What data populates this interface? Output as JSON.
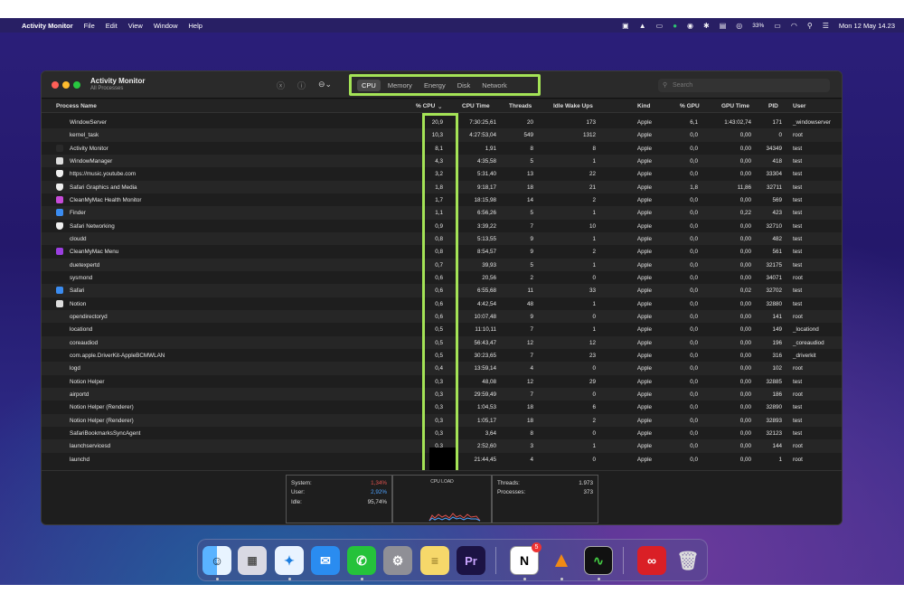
{
  "menubar": {
    "app": "Activity Monitor",
    "items": [
      "File",
      "Edit",
      "View",
      "Window",
      "Help"
    ],
    "battery": "33%",
    "datetime": "Mon 12 May  14.23"
  },
  "window": {
    "title": "Activity Monitor",
    "subtitle": "All Processes",
    "tabs": [
      "CPU",
      "Memory",
      "Energy",
      "Disk",
      "Network"
    ],
    "active_tab": "CPU",
    "search_placeholder": "Search"
  },
  "columns": [
    "Process Name",
    "% CPU",
    "CPU Time",
    "Threads",
    "Idle Wake Ups",
    "Kind",
    "% GPU",
    "GPU Time",
    "PID",
    "User"
  ],
  "processes": [
    {
      "name": "WindowServer",
      "cpu": "20,9",
      "cpu_time": "7:30:25,61",
      "threads": "20",
      "idle": "173",
      "kind": "Apple",
      "gpu": "6,1",
      "gpu_time": "1:43:02,74",
      "pid": "171",
      "user": "_windowserver",
      "icon": ""
    },
    {
      "name": "kernel_task",
      "cpu": "10,3",
      "cpu_time": "4:27:53,04",
      "threads": "549",
      "idle": "1312",
      "kind": "Apple",
      "gpu": "0,0",
      "gpu_time": "0,00",
      "pid": "0",
      "user": "root",
      "icon": ""
    },
    {
      "name": "Activity Monitor",
      "cpu": "8,1",
      "cpu_time": "1,91",
      "threads": "8",
      "idle": "8",
      "kind": "Apple",
      "gpu": "0,0",
      "gpu_time": "0,00",
      "pid": "34349",
      "user": "test",
      "icon": "activity-monitor-icon"
    },
    {
      "name": "WindowManager",
      "cpu": "4,3",
      "cpu_time": "4:35,58",
      "threads": "5",
      "idle": "1",
      "kind": "Apple",
      "gpu": "0,0",
      "gpu_time": "0,00",
      "pid": "418",
      "user": "test",
      "icon": "window-manager-icon"
    },
    {
      "name": "https://music.youtube.com",
      "cpu": "3,2",
      "cpu_time": "5:31,40",
      "threads": "13",
      "idle": "22",
      "kind": "Apple",
      "gpu": "0,0",
      "gpu_time": "0,00",
      "pid": "33304",
      "user": "test",
      "icon": "shield-icon"
    },
    {
      "name": "Safari Graphics and Media",
      "cpu": "1,8",
      "cpu_time": "9:18,17",
      "threads": "18",
      "idle": "21",
      "kind": "Apple",
      "gpu": "1,8",
      "gpu_time": "11,86",
      "pid": "32711",
      "user": "test",
      "icon": "shield-icon"
    },
    {
      "name": "CleanMyMac Health Monitor",
      "cpu": "1,7",
      "cpu_time": "18:15,98",
      "threads": "14",
      "idle": "2",
      "kind": "Apple",
      "gpu": "0,0",
      "gpu_time": "0,00",
      "pid": "569",
      "user": "test",
      "icon": "cleanmymac-icon"
    },
    {
      "name": "Finder",
      "cpu": "1,1",
      "cpu_time": "6:56,26",
      "threads": "5",
      "idle": "1",
      "kind": "Apple",
      "gpu": "0,0",
      "gpu_time": "0,22",
      "pid": "423",
      "user": "test",
      "icon": "finder-icon"
    },
    {
      "name": "Safari Networking",
      "cpu": "0,9",
      "cpu_time": "3:39,22",
      "threads": "7",
      "idle": "10",
      "kind": "Apple",
      "gpu": "0,0",
      "gpu_time": "0,00",
      "pid": "32710",
      "user": "test",
      "icon": "shield-icon"
    },
    {
      "name": "cloudd",
      "cpu": "0,8",
      "cpu_time": "5:13,55",
      "threads": "9",
      "idle": "1",
      "kind": "Apple",
      "gpu": "0,0",
      "gpu_time": "0,00",
      "pid": "482",
      "user": "test",
      "icon": ""
    },
    {
      "name": "CleanMyMac Menu",
      "cpu": "0,8",
      "cpu_time": "8:54,57",
      "threads": "9",
      "idle": "2",
      "kind": "Apple",
      "gpu": "0,0",
      "gpu_time": "0,00",
      "pid": "561",
      "user": "test",
      "icon": "cleanmymac-menu-icon"
    },
    {
      "name": "duetexpertd",
      "cpu": "0,7",
      "cpu_time": "39,93",
      "threads": "5",
      "idle": "1",
      "kind": "Apple",
      "gpu": "0,0",
      "gpu_time": "0,00",
      "pid": "32175",
      "user": "test",
      "icon": ""
    },
    {
      "name": "sysmond",
      "cpu": "0,6",
      "cpu_time": "20,56",
      "threads": "2",
      "idle": "0",
      "kind": "Apple",
      "gpu": "0,0",
      "gpu_time": "0,00",
      "pid": "34071",
      "user": "root",
      "icon": ""
    },
    {
      "name": "Safari",
      "cpu": "0,6",
      "cpu_time": "6:55,68",
      "threads": "11",
      "idle": "33",
      "kind": "Apple",
      "gpu": "0,0",
      "gpu_time": "0,02",
      "pid": "32702",
      "user": "test",
      "icon": "safari-icon"
    },
    {
      "name": "Notion",
      "cpu": "0,6",
      "cpu_time": "4:42,54",
      "threads": "48",
      "idle": "1",
      "kind": "Apple",
      "gpu": "0,0",
      "gpu_time": "0,00",
      "pid": "32880",
      "user": "test",
      "icon": "notion-icon"
    },
    {
      "name": "opendirectoryd",
      "cpu": "0,6",
      "cpu_time": "10:07,48",
      "threads": "9",
      "idle": "0",
      "kind": "Apple",
      "gpu": "0,0",
      "gpu_time": "0,00",
      "pid": "141",
      "user": "root",
      "icon": ""
    },
    {
      "name": "locationd",
      "cpu": "0,5",
      "cpu_time": "11:10,11",
      "threads": "7",
      "idle": "1",
      "kind": "Apple",
      "gpu": "0,0",
      "gpu_time": "0,00",
      "pid": "149",
      "user": "_locationd",
      "icon": ""
    },
    {
      "name": "coreaudiod",
      "cpu": "0,5",
      "cpu_time": "56:43,47",
      "threads": "12",
      "idle": "12",
      "kind": "Apple",
      "gpu": "0,0",
      "gpu_time": "0,00",
      "pid": "196",
      "user": "_coreaudiod",
      "icon": ""
    },
    {
      "name": "com.apple.DriverKit-AppleBCMWLAN",
      "cpu": "0,5",
      "cpu_time": "30:23,65",
      "threads": "7",
      "idle": "23",
      "kind": "Apple",
      "gpu": "0,0",
      "gpu_time": "0,00",
      "pid": "316",
      "user": "_driverkit",
      "icon": ""
    },
    {
      "name": "logd",
      "cpu": "0,4",
      "cpu_time": "13:59,14",
      "threads": "4",
      "idle": "0",
      "kind": "Apple",
      "gpu": "0,0",
      "gpu_time": "0,00",
      "pid": "102",
      "user": "root",
      "icon": ""
    },
    {
      "name": "Notion Helper",
      "cpu": "0,3",
      "cpu_time": "48,08",
      "threads": "12",
      "idle": "29",
      "kind": "Apple",
      "gpu": "0,0",
      "gpu_time": "0,00",
      "pid": "32885",
      "user": "test",
      "icon": ""
    },
    {
      "name": "airportd",
      "cpu": "0,3",
      "cpu_time": "29:59,49",
      "threads": "7",
      "idle": "0",
      "kind": "Apple",
      "gpu": "0,0",
      "gpu_time": "0,00",
      "pid": "186",
      "user": "root",
      "icon": ""
    },
    {
      "name": "Notion Helper (Renderer)",
      "cpu": "0,3",
      "cpu_time": "1:04,53",
      "threads": "18",
      "idle": "6",
      "kind": "Apple",
      "gpu": "0,0",
      "gpu_time": "0,00",
      "pid": "32890",
      "user": "test",
      "icon": ""
    },
    {
      "name": "Notion Helper (Renderer)",
      "cpu": "0,3",
      "cpu_time": "1:05,17",
      "threads": "18",
      "idle": "2",
      "kind": "Apple",
      "gpu": "0,0",
      "gpu_time": "0,00",
      "pid": "32893",
      "user": "test",
      "icon": ""
    },
    {
      "name": "SafariBookmarksSyncAgent",
      "cpu": "0,3",
      "cpu_time": "3,64",
      "threads": "8",
      "idle": "0",
      "kind": "Apple",
      "gpu": "0,0",
      "gpu_time": "0,00",
      "pid": "32123",
      "user": "test",
      "icon": ""
    },
    {
      "name": "launchservicesd",
      "cpu": "0,3",
      "cpu_time": "2:52,60",
      "threads": "3",
      "idle": "1",
      "kind": "Apple",
      "gpu": "0,0",
      "gpu_time": "0,00",
      "pid": "144",
      "user": "root",
      "icon": ""
    },
    {
      "name": "launchd",
      "cpu": "",
      "cpu_time": "21:44,45",
      "threads": "4",
      "idle": "0",
      "kind": "Apple",
      "gpu": "0,0",
      "gpu_time": "0,00",
      "pid": "1",
      "user": "root",
      "icon": ""
    }
  ],
  "summary": {
    "system_label": "System:",
    "system_value": "1,34%",
    "user_label": "User:",
    "user_value": "2,92%",
    "idle_label": "Idle:",
    "idle_value": "95,74%",
    "cpu_load_title": "CPU LOAD",
    "threads_label": "Threads:",
    "threads_value": "1.973",
    "processes_label": "Processes:",
    "processes_value": "373"
  },
  "colors": {
    "highlight": "#a4e356",
    "system": "#e0524f",
    "user": "#4ea3ff"
  },
  "dock": {
    "apps": [
      "finder-icon",
      "launchpad-icon",
      "safari-icon",
      "mail-icon",
      "whatsapp-icon",
      "system-settings-icon",
      "notes-icon",
      "premiere-icon",
      "notion-icon",
      "vlc-icon",
      "activity-monitor-icon",
      "creative-cloud-icon",
      "trash-icon"
    ],
    "notion_badge": "5",
    "premiere_label": "Pr",
    "notion_label": "N"
  }
}
